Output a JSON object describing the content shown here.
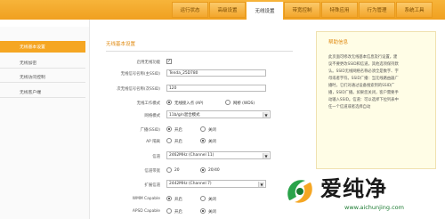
{
  "top_nav": {
    "tabs": [
      "运行状态",
      "高级设置",
      "无线设置",
      "带宽控制",
      "特殊应用",
      "行为管理",
      "系统工具"
    ],
    "active_index": 2
  },
  "sidebar": {
    "items": [
      "无线基本设置",
      "无线加密",
      "无线访问控制",
      "无线客户端"
    ],
    "active_index": 0
  },
  "main": {
    "section_title": "无线基本设置",
    "enable_wireless": {
      "label": "启用无线功能",
      "checked": true
    },
    "primary_ssid": {
      "label": "无线信号名称(主SSID)",
      "value": "Tenda_25D780"
    },
    "secondary_ssid": {
      "label": "次无线信号名称(次SSID)",
      "value": "120"
    },
    "work_mode": {
      "label": "无线工作模式",
      "options": [
        "无线接入点 (AP)",
        "网桥 (WDS)"
      ],
      "selected": 0
    },
    "network_mode": {
      "label": "网络模式",
      "value": "11b/g/n混合模式"
    },
    "broadcast_ssid": {
      "label": "广播(SSID)",
      "options": [
        "开启",
        "关闭"
      ],
      "selected": 0
    },
    "ap_isolation": {
      "label": "AP 隔离",
      "options": [
        "开启",
        "关闭"
      ],
      "selected": 1
    },
    "channel": {
      "label": "信道",
      "value": "2462MHz (Channel 11)"
    },
    "bandwidth": {
      "label": "信道带宽",
      "options": [
        "20",
        "20/40"
      ],
      "selected": 1
    },
    "ext_channel": {
      "label": "扩展信道",
      "value": "2442MHz (Channel 7)"
    },
    "wmm": {
      "label": "WMM Capable",
      "options": [
        "开启",
        "关闭"
      ],
      "selected": 0
    },
    "apsd": {
      "label": "APSD Capable",
      "options": [
        "开启",
        "关闭"
      ],
      "selected": 1
    }
  },
  "help": {
    "title": "帮助信息",
    "text": "此页面可修改无线基本信息及行设置，建议不要更改SSID和信道，其他选项保持默认。SSID无线网络名称必须全是数字、字母或者字符。SSID广播：当无线路由器广播时，它们对通过设备搜索到的SSID广播，SSID广播。如果您关闭，客户需要手动输入SSID。信道：可以选择下拉列表中任一个信道或者选择自动"
  },
  "watermark": {
    "brand": "爱纯净",
    "url": "www.aichunjing.com",
    "logo_icon": "swirl-logo-icon",
    "colors": {
      "brand_green": "#1a8f2e",
      "accent_orange": "#f5a623"
    }
  }
}
